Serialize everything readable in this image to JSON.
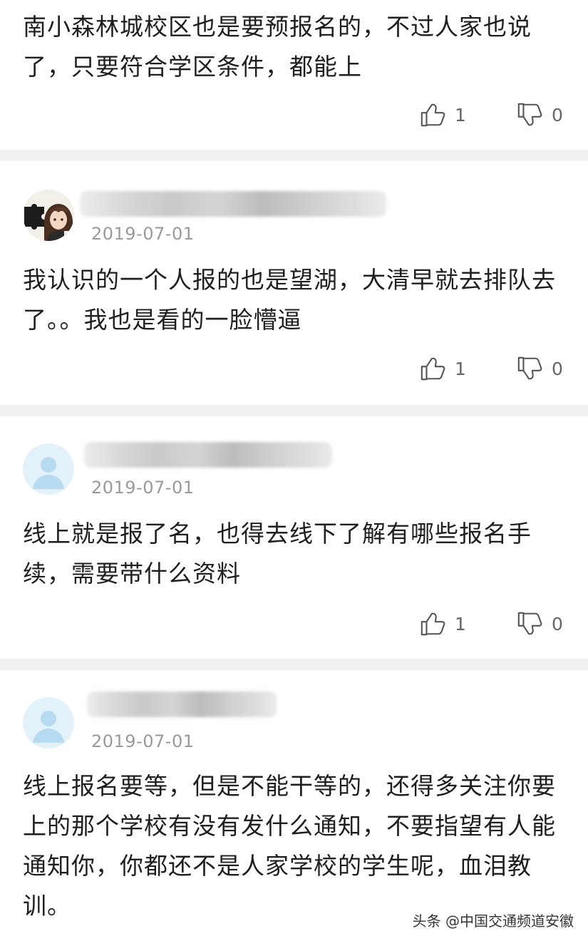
{
  "comments": [
    {
      "text": "南小森林城校区也是要预报名的，不过人家也说了，只要符合学区条件，都能上",
      "likes": "1",
      "dislikes": "0"
    },
    {
      "date": "2019-07-01",
      "text": "我认识的一个人报的也是望湖，大清早就去排队去了。。我也是看的一脸懵逼",
      "likes": "1",
      "dislikes": "0",
      "avatar_icon": "anime-avatar-icon"
    },
    {
      "date": "2019-07-01",
      "text": "线上就是报了名，也得去线下了解有哪些报名手续，需要带什么资料",
      "likes": "1",
      "dislikes": "0",
      "avatar_icon": "default-user-icon"
    },
    {
      "date": "2019-07-01",
      "text": "线上报名要等，但是不能干等的，还得多关注你要上的那个学校有没有发什么通知，不要指望有人能通知你，你都还不是人家学校的学生呢，血泪教训。",
      "avatar_icon": "default-user-icon"
    }
  ],
  "watermark": "头条 @中国交通频道安徽",
  "colors": {
    "separator": "#f1f1f1",
    "date": "#9a9a9a",
    "avatar_bg": "#e3f1fa",
    "avatar_figure": "#b7dcf1"
  }
}
